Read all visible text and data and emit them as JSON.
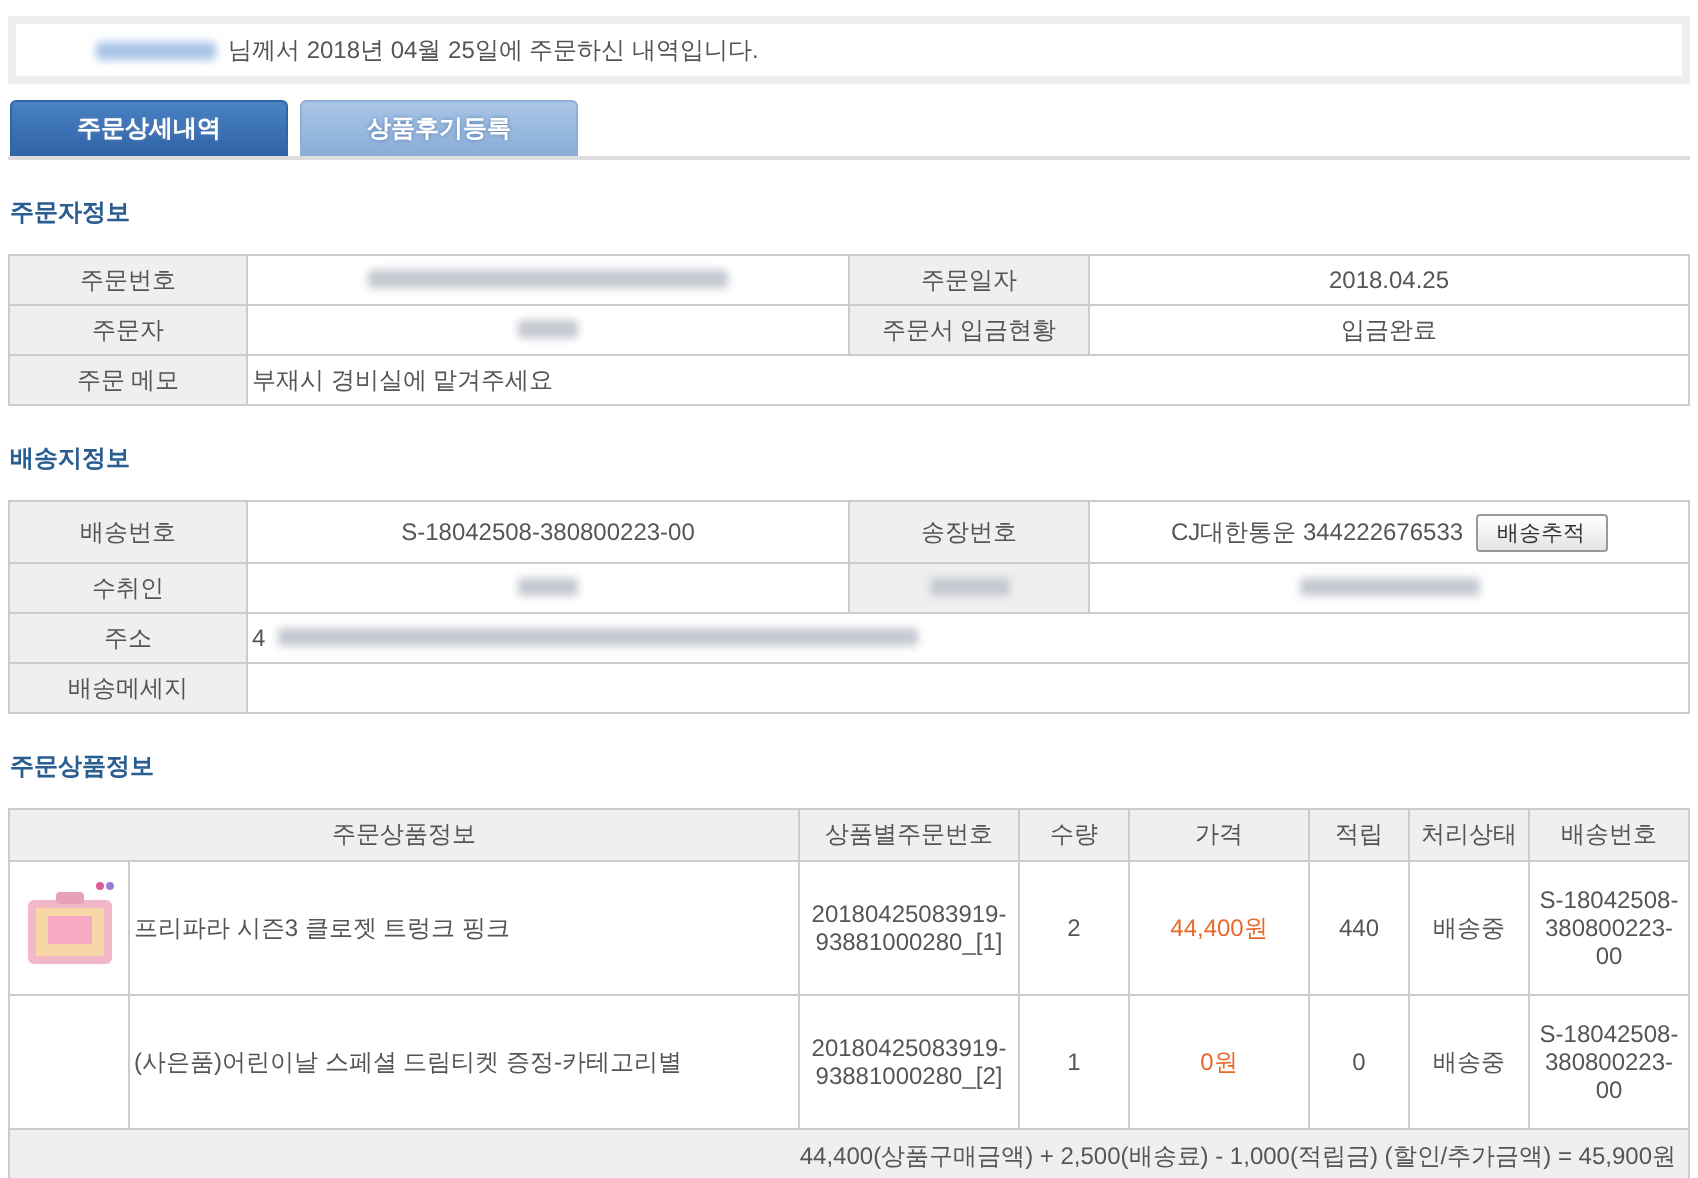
{
  "header": {
    "message": "님께서 2018년 04월 25일에 주문하신 내역입니다."
  },
  "tabs": [
    {
      "label": "주문상세내역",
      "selected": true
    },
    {
      "label": "상품후기등록",
      "selected": false
    }
  ],
  "orderer": {
    "title": "주문자정보",
    "order_no_label": "주문번호",
    "order_date_label": "주문일자",
    "order_date": "2018.04.25",
    "orderer_label": "주문자",
    "payment_status_label": "주문서 입금현황",
    "payment_status": "입금완료",
    "memo_label": "주문 메모",
    "memo": "부재시 경비실에 맡겨주세요"
  },
  "shipping": {
    "title": "배송지정보",
    "shipping_no_label": "배송번호",
    "shipping_no": "S-18042508-380800223-00",
    "invoice_label": "송장번호",
    "invoice": "CJ대한통운 344222676533",
    "track_button": "배송추적",
    "recipient_label": "수취인",
    "address_label": "주소",
    "address_start": "4",
    "message_label": "배송메세지"
  },
  "products": {
    "title": "주문상품정보",
    "columns": [
      "주문상품정보",
      "상품별주문번호",
      "수량",
      "가격",
      "적립",
      "처리상태",
      "배송번호"
    ],
    "rows": [
      {
        "has_image": true,
        "name": "프리파라 시즌3 클로젯 트렁크 핑크",
        "order_no": "20180425083919-93881000280_[1]",
        "qty": "2",
        "price": "44,400원",
        "points": "440",
        "status": "배송중",
        "shipping_no": "S-18042508-380800223-00"
      },
      {
        "has_image": false,
        "name": "(사은품)어린이날 스페셜 드림티켓 증정-카테고리별",
        "order_no": "20180425083919-93881000280_[2]",
        "qty": "1",
        "price": "0원",
        "points": "0",
        "status": "배송중",
        "shipping_no": "S-18042508-380800223-00"
      }
    ],
    "total": "44,400(상품구매금액) + 2,500(배송료) - 1,000(적립금) (할인/추가금액) = 45,900원"
  }
}
